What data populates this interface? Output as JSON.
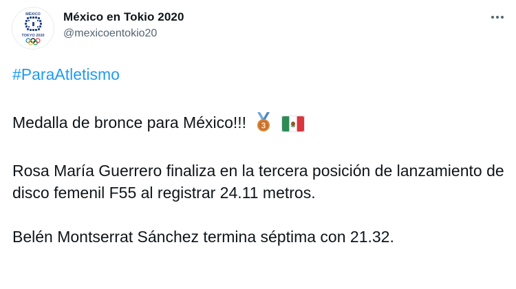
{
  "header": {
    "display_name": "México en Tokio 2020",
    "handle": "@mexicoentokio20",
    "avatar": {
      "icon": "tokyo-2020-mexico-logo",
      "logo_text_top": "MÉXICO",
      "logo_text_bottom": "TOKYO 2020"
    },
    "more_icon": "more-horizontal-icon"
  },
  "tweet": {
    "hashtag": "#ParaAtletismo",
    "line1": "Medalla de bronce para México!!!",
    "line1_emojis": [
      "third-place-medal-icon",
      "mexico-flag-icon"
    ],
    "paragraph2": "Rosa María Guerrero finaliza en la tercera posición de lanzamiento de disco femenil F55 al registrar 24.11 metros.",
    "paragraph3": "Belén Montserrat Sánchez termina séptima con 21.32."
  },
  "colors": {
    "text": "#0f1419",
    "secondary_text": "#536471",
    "link": "#1d9bf0",
    "logo_blue": "#2a4a8c"
  }
}
